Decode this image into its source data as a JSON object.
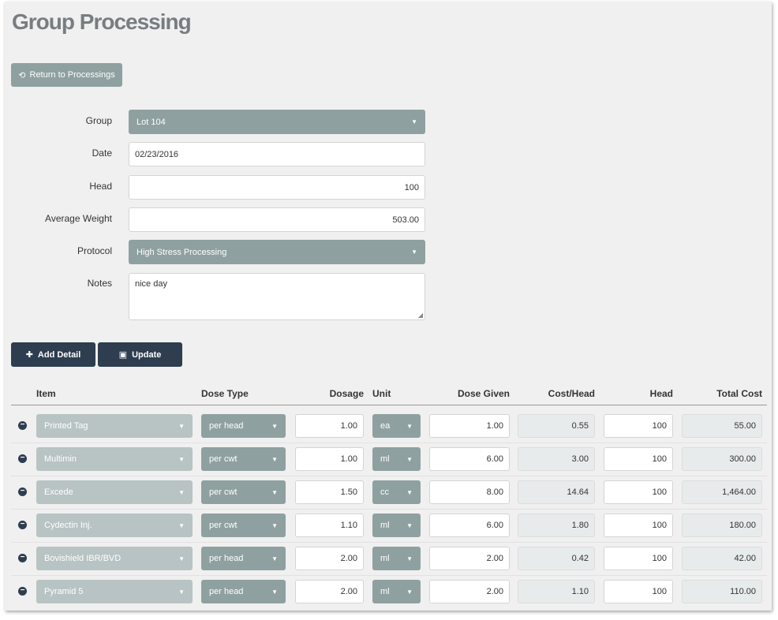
{
  "page": {
    "title": "Group Processing",
    "return_button": "Return to Processings"
  },
  "form": {
    "group_label": "Group",
    "group_value": "Lot 104",
    "date_label": "Date",
    "date_value": "02/23/2016",
    "head_label": "Head",
    "head_value": "100",
    "avg_weight_label": "Average Weight",
    "avg_weight_value": "503.00",
    "protocol_label": "Protocol",
    "protocol_value": "High Stress Processing",
    "notes_label": "Notes",
    "notes_value": "nice day"
  },
  "actions": {
    "add_detail": "Add Detail",
    "update": "Update"
  },
  "table": {
    "headers": {
      "item": "Item",
      "dose_type": "Dose Type",
      "dosage": "Dosage",
      "unit": "Unit",
      "dose_given": "Dose Given",
      "cost_head": "Cost/Head",
      "head": "Head",
      "total_cost": "Total Cost"
    },
    "rows": [
      {
        "item": "Printed Tag",
        "dose_type": "per head",
        "dosage": "1.00",
        "unit": "ea",
        "dose_given": "1.00",
        "cost_head": "0.55",
        "head": "100",
        "total_cost": "55.00"
      },
      {
        "item": "Multimin",
        "dose_type": "per cwt",
        "dosage": "1.00",
        "unit": "ml",
        "dose_given": "6.00",
        "cost_head": "3.00",
        "head": "100",
        "total_cost": "300.00"
      },
      {
        "item": "Excede",
        "dose_type": "per cwt",
        "dosage": "1.50",
        "unit": "cc",
        "dose_given": "8.00",
        "cost_head": "14.64",
        "head": "100",
        "total_cost": "1,464.00"
      },
      {
        "item": "Cydectin Inj.",
        "dose_type": "per cwt",
        "dosage": "1.10",
        "unit": "ml",
        "dose_given": "6.00",
        "cost_head": "1.80",
        "head": "100",
        "total_cost": "180.00"
      },
      {
        "item": "Bovishield IBR/BVD",
        "dose_type": "per head",
        "dosage": "2.00",
        "unit": "ml",
        "dose_given": "2.00",
        "cost_head": "0.42",
        "head": "100",
        "total_cost": "42.00"
      },
      {
        "item": "Pyramid 5",
        "dose_type": "per head",
        "dosage": "2.00",
        "unit": "ml",
        "dose_given": "2.00",
        "cost_head": "1.10",
        "head": "100",
        "total_cost": "110.00"
      }
    ]
  },
  "colors": {
    "select_bg": "#8fa0a0",
    "item_select_bg": "#b8c3c3",
    "dark_button": "#2e3d4f"
  },
  "icons": {
    "return": "undo-icon",
    "add": "plus-icon",
    "update": "save-icon",
    "remove": "minus-circle-icon",
    "dropdown": "caret-down-icon"
  }
}
